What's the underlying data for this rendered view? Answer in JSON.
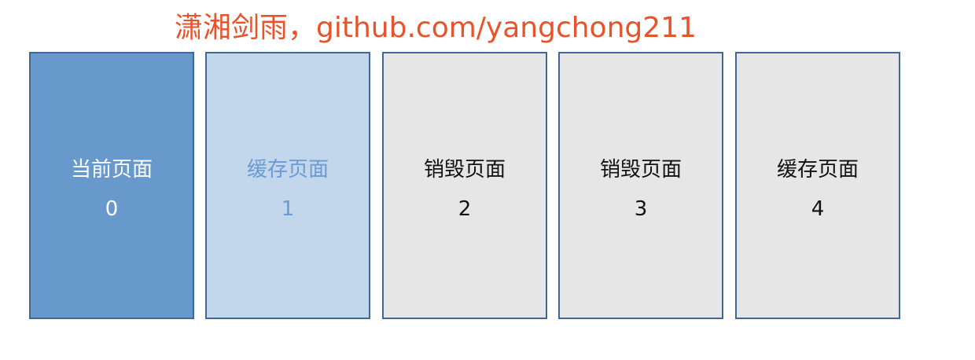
{
  "watermark": "潇湘剑雨，github.com/yangchong211",
  "pages": [
    {
      "label": "当前页面",
      "index": "0"
    },
    {
      "label": "缓存页面",
      "index": "1"
    },
    {
      "label": "销毁页面",
      "index": "2"
    },
    {
      "label": "销毁页面",
      "index": "3"
    },
    {
      "label": "缓存页面",
      "index": "4"
    }
  ],
  "colors": {
    "watermark": "#e8532b",
    "border": "#3f6897",
    "current_fill": "#6899cc",
    "cached_adjacent_fill": "#c2d7eb",
    "cached_adjacent_text": "#6b9bd1",
    "default_fill": "#e6e6e6"
  }
}
